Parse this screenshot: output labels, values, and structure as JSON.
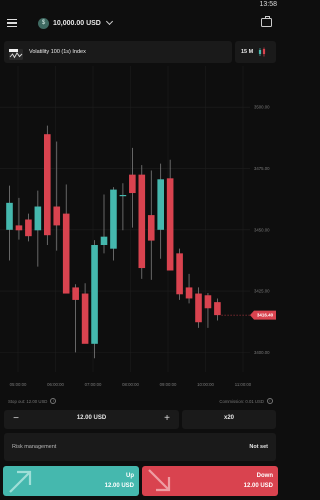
{
  "status_bar": {
    "time": "13:58"
  },
  "header": {
    "currency_symbol": "$",
    "balance": "10,000.00 USD",
    "icons": {
      "menu": "menu-icon",
      "balance_chevron": "chevron-down-icon",
      "portfolio": "briefcase-icon"
    }
  },
  "symbol": {
    "name": "Volatility 100 (1s) Index",
    "icon": "volatility-index-icon"
  },
  "timeframe": {
    "label": "15 M",
    "icon": "candlestick-icon"
  },
  "chart_data": {
    "type": "candlestick",
    "title": "",
    "x_ticks": [
      "05:00:00",
      "06:00:00",
      "07:00:00",
      "08:00:00",
      "09:00:00",
      "10:00:00",
      "11:00:00"
    ],
    "y_ticks": [
      3500.0,
      3475.0,
      3450.0,
      3425.0,
      3400.0
    ],
    "ylim": [
      3392,
      3516
    ],
    "current_price": "3416.40",
    "colors": {
      "up": "#45b8ae",
      "down": "#d9434f",
      "grid": "#1e1e1e",
      "label": "#7a7a7a"
    },
    "candles": [
      {
        "open": 3450.0,
        "high": 3468.0,
        "low": 3437.5,
        "close": 3461.0
      },
      {
        "open": 3451.8,
        "high": 3463.0,
        "low": 3446.0,
        "close": 3449.8
      },
      {
        "open": 3454.2,
        "high": 3456.6,
        "low": 3445.3,
        "close": 3447.4
      },
      {
        "open": 3449.8,
        "high": 3466.0,
        "low": 3435.0,
        "close": 3459.5
      },
      {
        "open": 3489.0,
        "high": 3492.5,
        "low": 3443.8,
        "close": 3447.8
      },
      {
        "open": 3459.5,
        "high": 3486.0,
        "low": 3441.5,
        "close": 3451.8
      },
      {
        "open": 3456.6,
        "high": 3468.5,
        "low": 3445.3,
        "close": 3424.0
      },
      {
        "open": 3426.5,
        "high": 3427.8,
        "low": 3400.0,
        "close": 3421.4
      },
      {
        "open": 3424.0,
        "high": 3428.2,
        "low": 3406.0,
        "close": 3403.5
      },
      {
        "open": 3403.5,
        "high": 3445.8,
        "low": 3397.6,
        "close": 3443.8
      },
      {
        "open": 3443.8,
        "high": 3464.4,
        "low": 3440.4,
        "close": 3447.2
      },
      {
        "open": 3442.3,
        "high": 3467.4,
        "low": 3437.5,
        "close": 3466.4
      },
      {
        "open": 3464.0,
        "high": 3469.0,
        "low": 3449.8,
        "close": 3464.2
      },
      {
        "open": 3472.5,
        "high": 3483.4,
        "low": 3450.9,
        "close": 3465.0
      },
      {
        "open": 3472.5,
        "high": 3476.4,
        "low": 3430.0,
        "close": 3434.4
      },
      {
        "open": 3456.0,
        "high": 3474.2,
        "low": 3429.6,
        "close": 3445.6
      },
      {
        "open": 3450.0,
        "high": 3477.0,
        "low": 3438.2,
        "close": 3470.6
      },
      {
        "open": 3471.0,
        "high": 3478.6,
        "low": 3446.0,
        "close": 3433.4
      },
      {
        "open": 3440.4,
        "high": 3442.3,
        "low": 3421.4,
        "close": 3423.7
      },
      {
        "open": 3426.5,
        "high": 3432.0,
        "low": 3420.0,
        "close": 3422.0
      },
      {
        "open": 3424.0,
        "high": 3426.5,
        "low": 3410.0,
        "close": 3412.3
      },
      {
        "open": 3423.3,
        "high": 3424.2,
        "low": 3410.0,
        "close": 3418.0
      },
      {
        "open": 3420.5,
        "high": 3422.0,
        "low": 3413.0,
        "close": 3415.2
      }
    ]
  },
  "trade_info": {
    "stop_out_label": "Stop out: 12.00 USD",
    "commission_label": "Commission: 0.01 USD",
    "info_icon_glyph": "i"
  },
  "stake": {
    "minus": "−",
    "value": "12.00 USD",
    "plus": "+"
  },
  "multiplier": {
    "value": "x20"
  },
  "risk": {
    "label": "Risk management",
    "value": "Not set"
  },
  "up_button": {
    "label": "Up",
    "amount": "12.00 USD",
    "icon": "arrow-up-right-icon"
  },
  "down_button": {
    "label": "Down",
    "amount": "12.00 USD",
    "icon": "arrow-down-right-icon"
  }
}
